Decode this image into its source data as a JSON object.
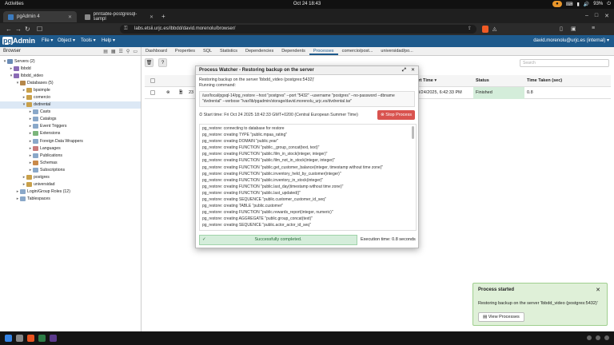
{
  "system": {
    "activities": "Activities",
    "clock": "Oct 24  18:43",
    "tray_pill": "●",
    "tray_items": [
      "⌨",
      "▮",
      "🔊",
      "⏻"
    ],
    "battery": "93%"
  },
  "browser": {
    "tabs": [
      {
        "title": "pgAdmin 4",
        "active": true
      },
      {
        "title": "printable-postgresql-sampl",
        "active": false
      }
    ],
    "url": "labs.etsii.urjc.es/lbbdd/david.morenolu/browser/"
  },
  "pgadmin": {
    "logo_pg": "pg",
    "logo_admin": "Admin",
    "menu": [
      "File ▾",
      "Object ▾",
      "Tools ▾",
      "Help ▾"
    ],
    "user": "david.morenolu@urjc.es (internal) ▾"
  },
  "left_panel": {
    "title": "Browser",
    "tree": [
      {
        "label": "Servers (2)",
        "level": 0,
        "arrow": "▾",
        "color": "#6a8bb5"
      },
      {
        "label": "lbbdd",
        "level": 1,
        "arrow": "▸",
        "color": "#8a6bb5"
      },
      {
        "label": "lbbdd_video",
        "level": 1,
        "arrow": "▾",
        "color": "#8a6bb5"
      },
      {
        "label": "Databases (5)",
        "level": 2,
        "arrow": "▾",
        "color": "#b5874a"
      },
      {
        "label": "bpsimple",
        "level": 3,
        "arrow": "▸",
        "color": "#c9a04a"
      },
      {
        "label": "comercio",
        "level": 3,
        "arrow": "▸",
        "color": "#c9a04a"
      },
      {
        "label": "dvdrental",
        "level": 3,
        "arrow": "▾",
        "color": "#c9a04a",
        "selected": true
      },
      {
        "label": "Casts",
        "level": 4,
        "arrow": "▸",
        "color": "#8aa8c9"
      },
      {
        "label": "Catalogs",
        "level": 4,
        "arrow": "▸",
        "color": "#8aa8c9"
      },
      {
        "label": "Event Triggers",
        "level": 4,
        "arrow": "▸",
        "color": "#8aa8c9"
      },
      {
        "label": "Extensions",
        "level": 4,
        "arrow": "▸",
        "color": "#7bb57b"
      },
      {
        "label": "Foreign Data Wrappers",
        "level": 4,
        "arrow": "▸",
        "color": "#8aa8c9"
      },
      {
        "label": "Languages",
        "level": 4,
        "arrow": "▸",
        "color": "#c97b7b"
      },
      {
        "label": "Publications",
        "level": 4,
        "arrow": "▸",
        "color": "#8aa8c9"
      },
      {
        "label": "Schemas",
        "level": 4,
        "arrow": "▸",
        "color": "#c98a4a"
      },
      {
        "label": "Subscriptions",
        "level": 4,
        "arrow": "▸",
        "color": "#8aa8c9"
      },
      {
        "label": "postgres",
        "level": 3,
        "arrow": "▸",
        "color": "#c9a04a"
      },
      {
        "label": "universidad",
        "level": 3,
        "arrow": "▸",
        "color": "#c9a04a"
      },
      {
        "label": "Login/Group Roles (12)",
        "level": 2,
        "arrow": "▸",
        "color": "#8aa8c9"
      },
      {
        "label": "Tablespaces",
        "level": 2,
        "arrow": "▸",
        "color": "#8aa8c9"
      }
    ]
  },
  "right_panel": {
    "tabs": [
      "Dashboard",
      "Properties",
      "SQL",
      "Statistics",
      "Dependencies",
      "Dependents",
      "Processes",
      "comercio/post...",
      "universidad/po..."
    ],
    "active_tab": "Processes",
    "search_placeholder": "Search",
    "table": {
      "headers": [
        "",
        "",
        "",
        "PID",
        "",
        "Start Time ▾",
        "Status",
        "Time Taken (sec)"
      ],
      "row": {
        "pid": "23",
        "start_time": "10/24/2025, 6:42:33 PM",
        "status": "Finished",
        "time_taken": "0.8"
      }
    }
  },
  "dialog": {
    "title": "Process Watcher - Restoring backup on the server",
    "line1": "Restoring backup on the server 'lbbdd_video (postgres:5432)'",
    "line2": "Running command:",
    "command": "/usr/local/pgsql-14/pg_restore --host \"postgres\" --port \"5432\" --username \"postgres\" --no-password --dbname \"dvdrental\" --verbose \"/var/lib/pgadmin/storage/david.morenolu_urjc.es/dvdrental.tar\"",
    "start_time": "Start time: Fri Oct 24 2025 18:42:33 GMT+0200 (Central European Summer Time)",
    "stop_label": "Stop Process",
    "log": [
      "pg_restore: connecting to database for restore",
      "pg_restore: creating TYPE \"public.mpaa_rating\"",
      "pg_restore: creating DOMAIN \"public.year\"",
      "pg_restore: creating FUNCTION \"public._group_concat(text, text)\"",
      "pg_restore: creating FUNCTION \"public.film_in_stock(integer, integer)\"",
      "pg_restore: creating FUNCTION \"public.film_not_in_stock(integer, integer)\"",
      "pg_restore: creating FUNCTION \"public.get_customer_balance(integer, timestamp without time zone)\"",
      "pg_restore: creating FUNCTION \"public.inventory_held_by_customer(integer)\"",
      "pg_restore: creating FUNCTION \"public.inventory_in_stock(integer)\"",
      "pg_restore: creating FUNCTION \"public.last_day(timestamp without time zone)\"",
      "pg_restore: creating FUNCTION \"public.last_updated()\"",
      "pg_restore: creating SEQUENCE \"public.customer_customer_id_seq\"",
      "pg_restore: creating TABLE \"public.customer\"",
      "pg_restore: creating FUNCTION \"public.rewards_report(integer, numeric)\"",
      "pg_restore: creating AGGREGATE \"public.group_concat(text)\"",
      "pg_restore: creating SEQUENCE \"public.actor_actor_id_seq\"",
      "pg_restore: creating TABLE \"public.actor\""
    ],
    "success": "Successfully completed.",
    "exec_time": "Execution time: 0.8 seconds"
  },
  "toast": {
    "title": "Process started",
    "message": "Restoring backup on the server 'lbbdd_video (postgres:5432)'",
    "button": "View Processes"
  }
}
